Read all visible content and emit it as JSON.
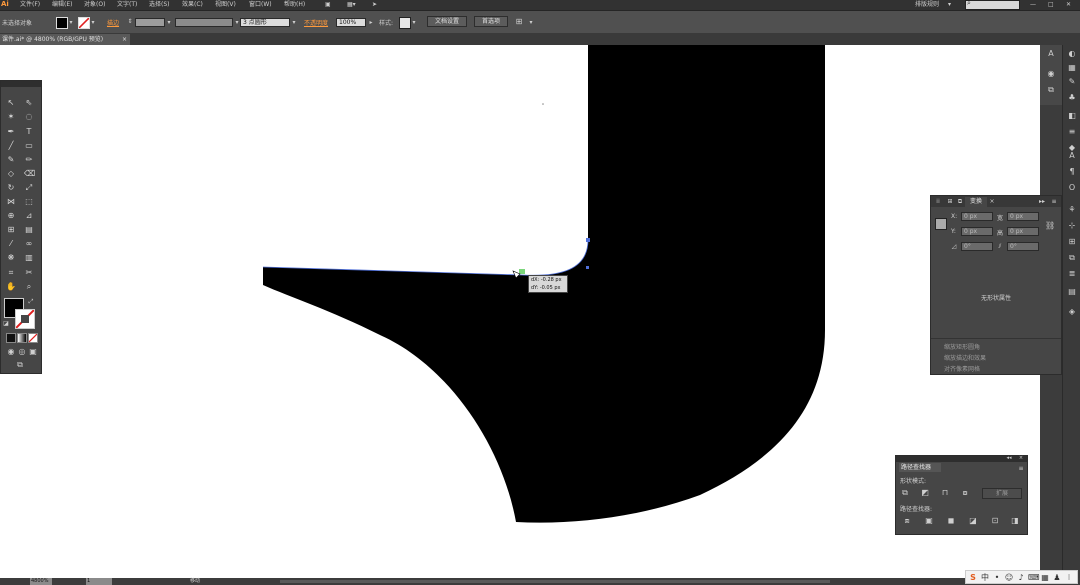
{
  "app": {
    "logo": "Ai"
  },
  "menu": [
    "文件(F)",
    "编辑(E)",
    "对象(O)",
    "文字(T)",
    "选择(S)",
    "效果(C)",
    "视图(V)",
    "窗口(W)",
    "帮助(H)"
  ],
  "workspace": {
    "label": "排版规则",
    "search_placeholder": ""
  },
  "control_bar": {
    "selection": "未选择对象",
    "stroke_label": "描边",
    "brush_value": "3 点圆形",
    "opacity_label": "不透明度",
    "opacity_value": "100%",
    "style_label": "样式:",
    "doc_setup": "文档设置",
    "preferences": "首选项"
  },
  "document_tab": {
    "title": "课件.ai* @ 4800% (RGB/GPU 预览)",
    "close": "×"
  },
  "tooltip": {
    "dx": "dX: -0.28 px",
    "dy": "dY: -0.05 px"
  },
  "transform_panel": {
    "tabs": [
      "变换"
    ],
    "x_label": "X:",
    "x_value": "0 px",
    "y_label": "Y:",
    "y_value": "0 px",
    "w_label": "宽",
    "w_value": "0 px",
    "h_label": "高",
    "h_value": "0 px",
    "angle_value": "0°",
    "shear_value": "0°",
    "no_shape": "无形状属性",
    "options": [
      "缩放矩形圆角",
      "缩放描边和效果",
      "对齐像素网格"
    ]
  },
  "pathfinder_panel": {
    "title": "路径查找器",
    "shape_modes": "形状模式:",
    "expand": "扩展",
    "pathfinders": "路径查找器:"
  },
  "status_bar": {
    "zoom": "4800%",
    "page": "1",
    "mode": "移动"
  },
  "colors": {
    "chrome_dark": "#323232",
    "chrome_mid": "#505050",
    "panel": "#464646",
    "canvas": "#ffffff",
    "shape_fill": "#000000",
    "anchor_selected": "#7bd67b",
    "path_outline": "#4f6fd8",
    "accent_orange": "#ff9a3c"
  }
}
